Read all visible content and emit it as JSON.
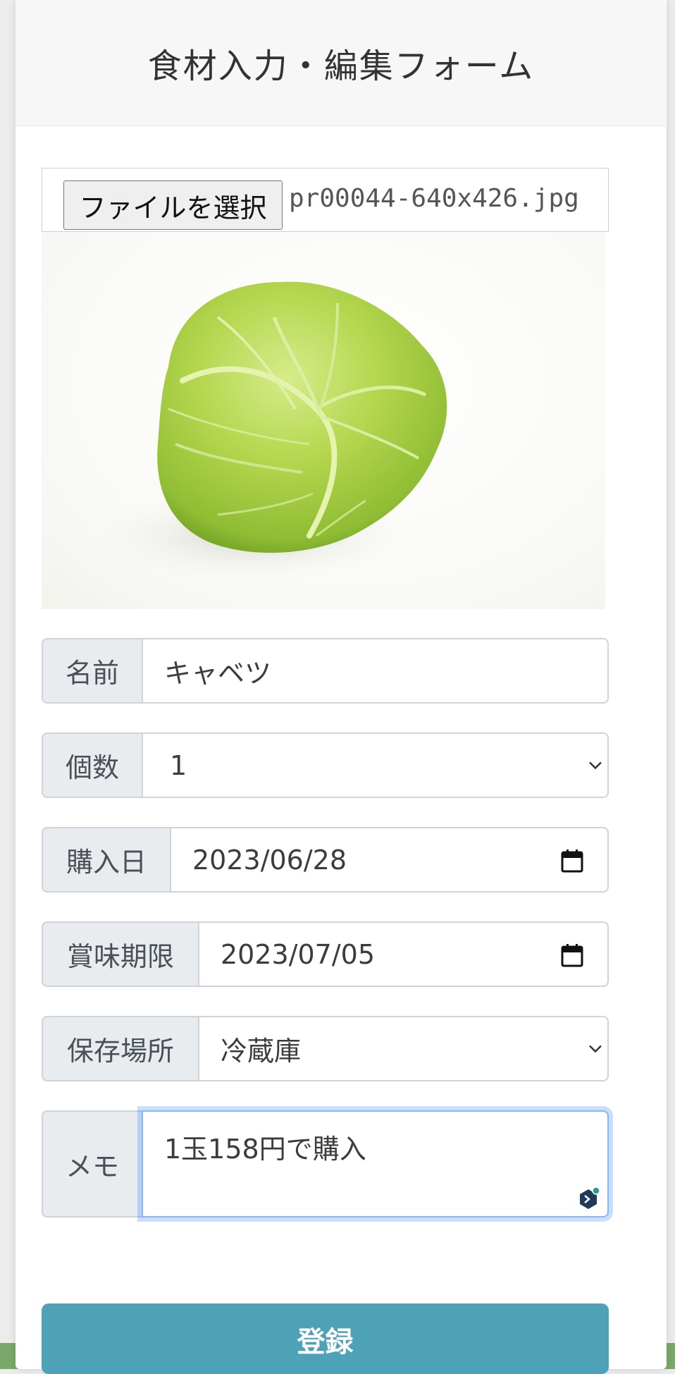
{
  "header": {
    "title": "食材入力・編集フォーム"
  },
  "file_input": {
    "button_label": "ファイルを選択",
    "file_name": "pr00044-640x426.jpg"
  },
  "photo": {
    "subject": "cabbage-photo"
  },
  "fields": {
    "name": {
      "label": "名前",
      "value": "キャベツ"
    },
    "quantity": {
      "label": "個数",
      "value": "1"
    },
    "purchase_date": {
      "label": "購入日",
      "value": "2023/06/28"
    },
    "expiry_date": {
      "label": "賞味期限",
      "value": "2023/07/05"
    },
    "storage": {
      "label": "保存場所",
      "value": "冷蔵庫"
    },
    "memo": {
      "label": "メモ",
      "value": "1玉158円で購入"
    }
  },
  "submit": {
    "label": "登録"
  },
  "icons": {
    "select_arrow": "chevron-down-icon",
    "date_picker": "calendar-icon",
    "assistant": "grammar-assistant-icon"
  },
  "colors": {
    "primary_button": "#4ea2b8",
    "label_bg": "#e9ecef",
    "focus_ring": "#86b7fe",
    "footer_bar": "#7aa96a"
  }
}
